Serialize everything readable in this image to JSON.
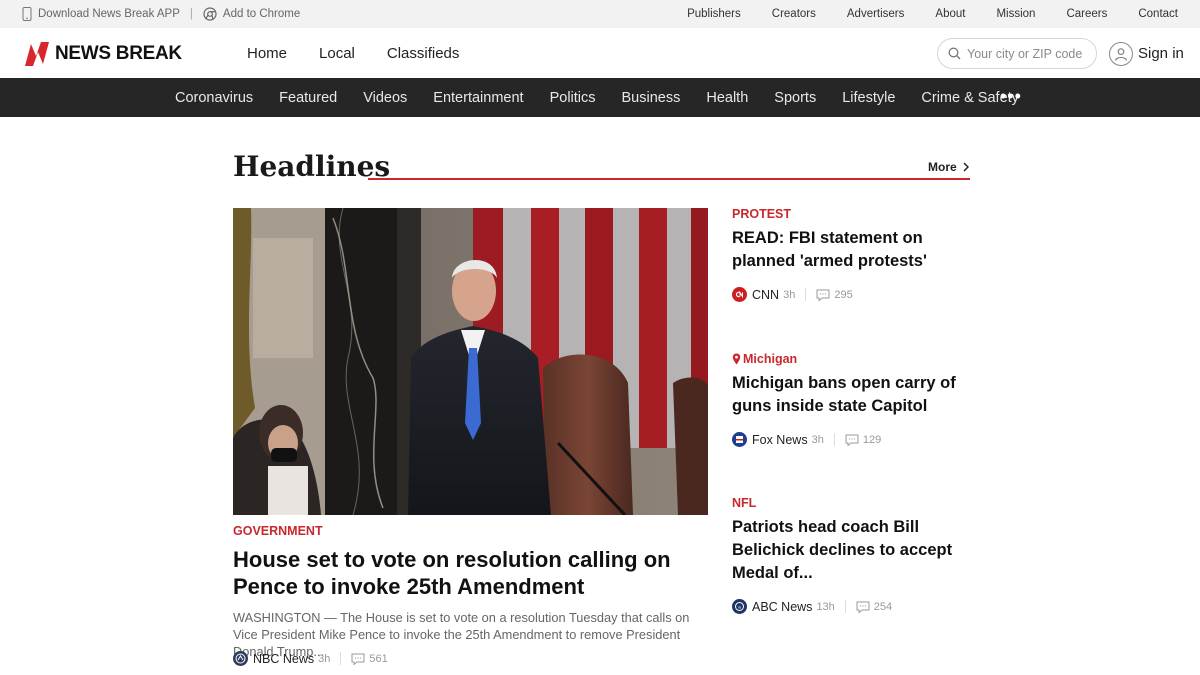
{
  "topbar": {
    "download_app": "Download News Break APP",
    "add_chrome": "Add to Chrome",
    "links": [
      "Publishers",
      "Creators",
      "Advertisers",
      "About",
      "Mission",
      "Careers",
      "Contact"
    ]
  },
  "header": {
    "logo_text": "NEWS BREAK",
    "nav": [
      "Home",
      "Local",
      "Classifieds"
    ],
    "search_placeholder": "Your city or ZIP code",
    "signin_label": "Sign in"
  },
  "categories": [
    "Coronavirus",
    "Featured",
    "Videos",
    "Entertainment",
    "Politics",
    "Business",
    "Health",
    "Sports",
    "Lifestyle",
    "Crime & Safety"
  ],
  "headlines": {
    "title": "Headlines",
    "more_label": "More",
    "feature": {
      "kicker": "GOVERNMENT",
      "title": "House set to vote on resolution calling on Pence to invoke 25th Amendment",
      "description": "WASHINGTON — The House is set to vote on a resolution Tuesday that calls on Vice President Mike Pence to invoke the 25th Amendment to remove President Donald Trump...",
      "source": "NBC News",
      "age": "3h",
      "comments": "561"
    },
    "side_stories": [
      {
        "kicker": "PROTEST",
        "title": "READ: FBI statement on planned 'armed protests'",
        "source": "CNN",
        "age": "3h",
        "comments": "295"
      },
      {
        "kicker": "Michigan",
        "title": "Michigan bans open carry of guns inside state Capitol",
        "source": "Fox News",
        "age": "3h",
        "comments": "129"
      },
      {
        "kicker": "NFL",
        "title": "Patriots head coach Bill Belichick declines to accept Medal of...",
        "source": "ABC News",
        "age": "13h",
        "comments": "254"
      }
    ]
  },
  "colors": {
    "accent": "#c9282d",
    "category_bar": "#262626",
    "topbar": "#f2f2f2"
  }
}
